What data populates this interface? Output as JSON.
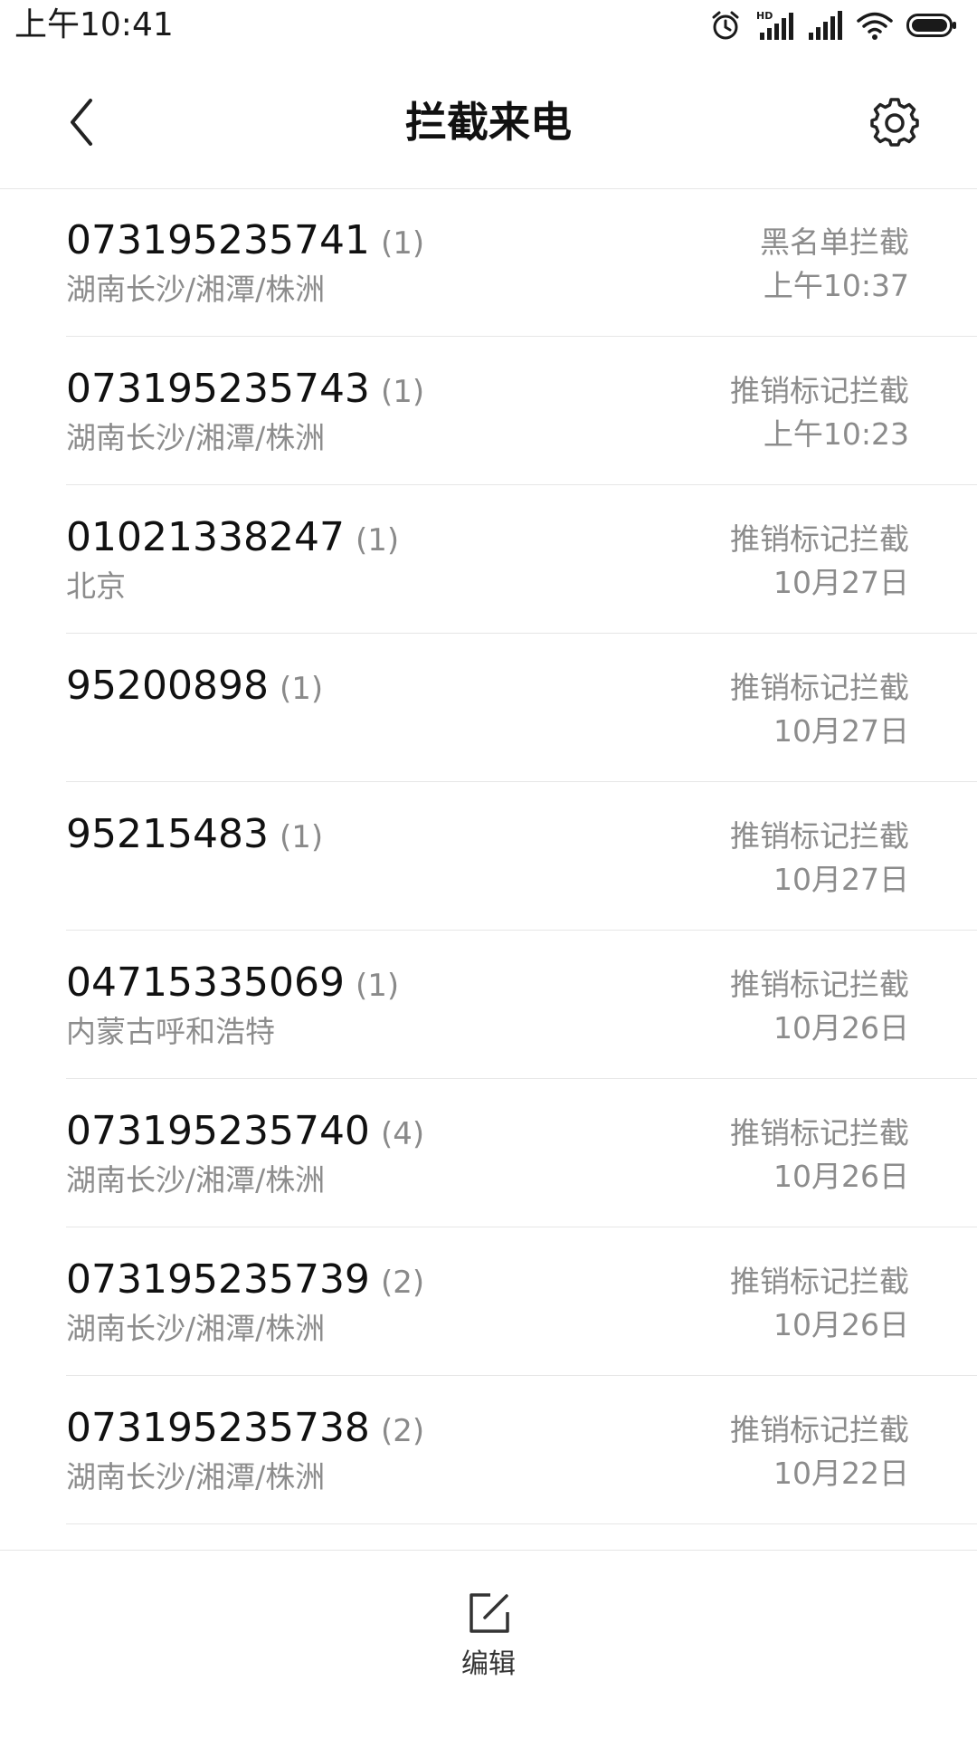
{
  "status_bar": {
    "time": "上午10:41",
    "network_badge": "HD",
    "icons": [
      "alarm-icon",
      "hd-signal-icon",
      "signal-icon",
      "wifi-icon",
      "battery-icon"
    ]
  },
  "header": {
    "title": "拦截来电",
    "back_icon": "chevron-left-icon",
    "settings_icon": "gear-icon"
  },
  "calls": [
    {
      "number": "073195235741",
      "count": "(1)",
      "location": "湖南长沙/湘潭/株洲",
      "reason": "黑名单拦截",
      "time": "上午10:37"
    },
    {
      "number": "073195235743",
      "count": "(1)",
      "location": "湖南长沙/湘潭/株洲",
      "reason": "推销标记拦截",
      "time": "上午10:23"
    },
    {
      "number": "01021338247",
      "count": "(1)",
      "location": "北京",
      "reason": "推销标记拦截",
      "time": "10月27日"
    },
    {
      "number": "95200898",
      "count": "(1)",
      "location": "",
      "reason": "推销标记拦截",
      "time": "10月27日"
    },
    {
      "number": "95215483",
      "count": "(1)",
      "location": "",
      "reason": "推销标记拦截",
      "time": "10月27日"
    },
    {
      "number": "04715335069",
      "count": "(1)",
      "location": "内蒙古呼和浩特",
      "reason": "推销标记拦截",
      "time": "10月26日"
    },
    {
      "number": "073195235740",
      "count": "(4)",
      "location": "湖南长沙/湘潭/株洲",
      "reason": "推销标记拦截",
      "time": "10月26日"
    },
    {
      "number": "073195235739",
      "count": "(2)",
      "location": "湖南长沙/湘潭/株洲",
      "reason": "推销标记拦截",
      "time": "10月26日"
    },
    {
      "number": "073195235738",
      "count": "(2)",
      "location": "湖南长沙/湘潭/株洲",
      "reason": "推销标记拦截",
      "time": "10月22日"
    }
  ],
  "bottom_bar": {
    "edit_label": "编辑",
    "edit_icon": "edit-icon"
  }
}
